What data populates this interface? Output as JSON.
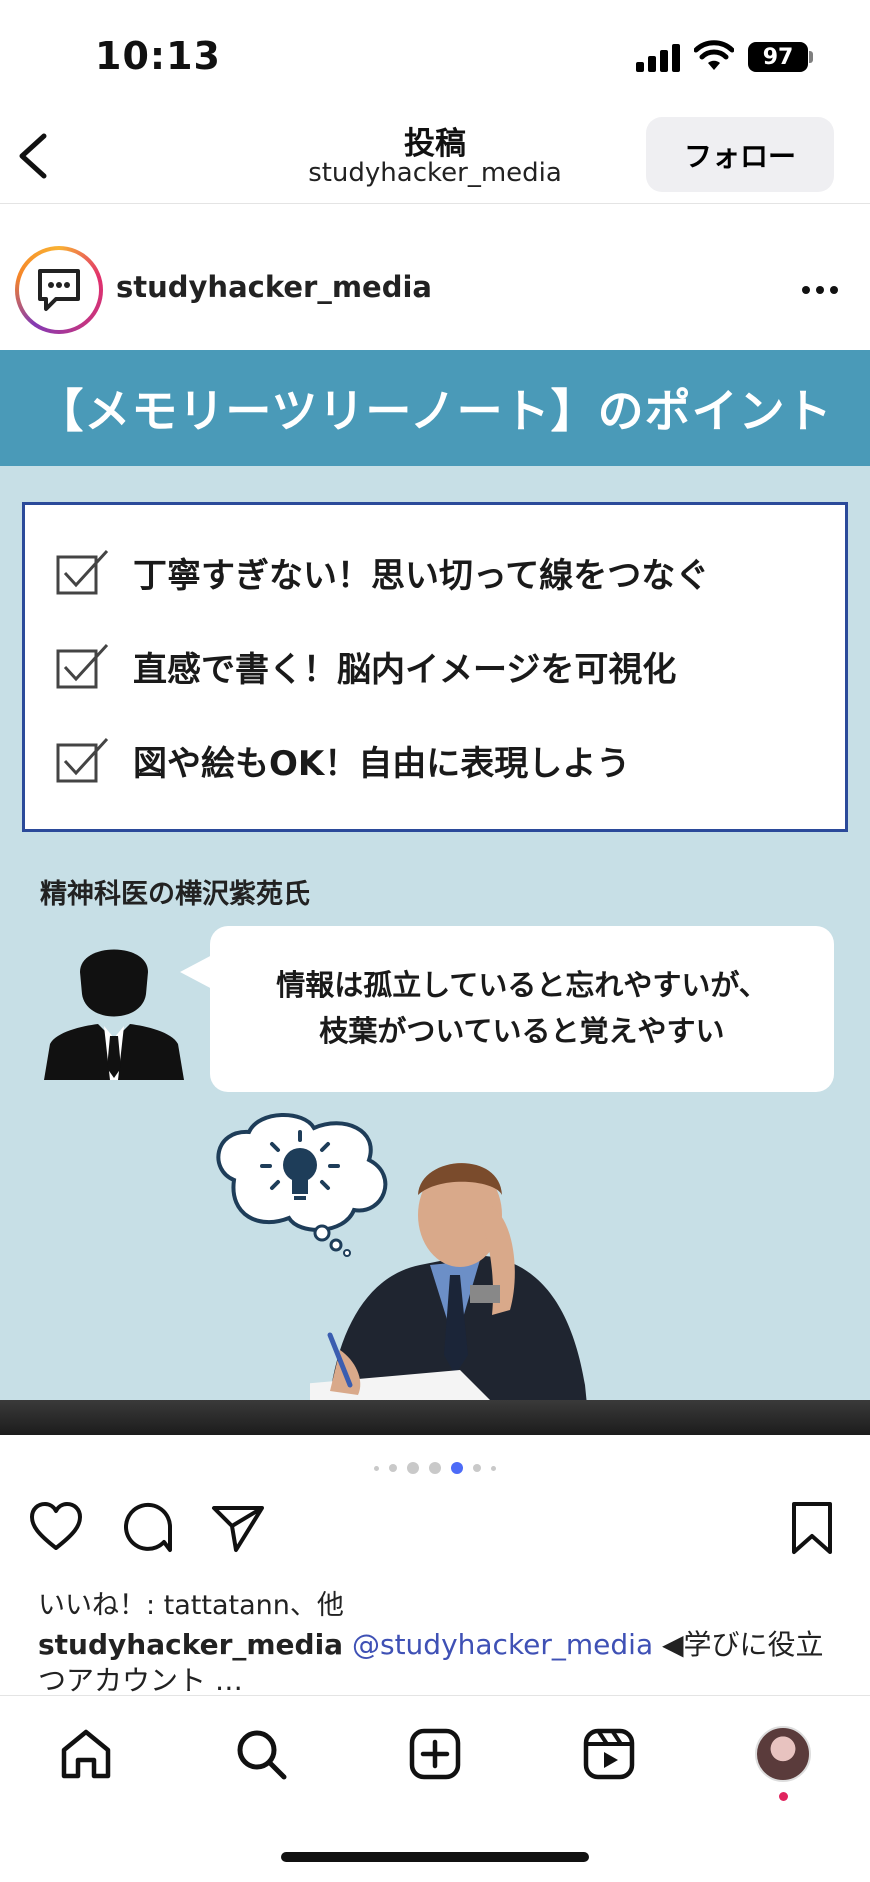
{
  "status_bar": {
    "time": "10:13",
    "battery": "97"
  },
  "header": {
    "title": "投稿",
    "subtitle": "studyhacker_media",
    "follow_label": "フォロー"
  },
  "post": {
    "author": "studyhacker_media",
    "image": {
      "banner": "【メモリーツリーノート】のポイント",
      "checklist": [
        "丁寧すぎない！思い切って線をつなぐ",
        "直感で書く！脳内イメージを可視化",
        "図や絵もOK！自由に表現しよう"
      ],
      "doctor_label": "精神科医の樺沢紫苑氏",
      "quote_line1": "情報は孤立していると忘れやすいが、",
      "quote_line2": "枝葉がついていると覚えやすい"
    },
    "carousel": {
      "count": 7,
      "active_index": 4
    },
    "likes": "いいね！: tattatann、他",
    "caption": {
      "user": "studyhacker_media",
      "mention": "@studyhacker_media",
      "text": " ◀学びに役立つアカウント …"
    }
  },
  "colors": {
    "banner": "#4a9ab8",
    "image_bg": "#c7dfe6",
    "check_border": "#2b4a9a",
    "active_dot": "#4d6bf7"
  },
  "bottom_nav": [
    "home-icon",
    "search-icon",
    "create-icon",
    "reels-icon",
    "profile-avatar"
  ]
}
